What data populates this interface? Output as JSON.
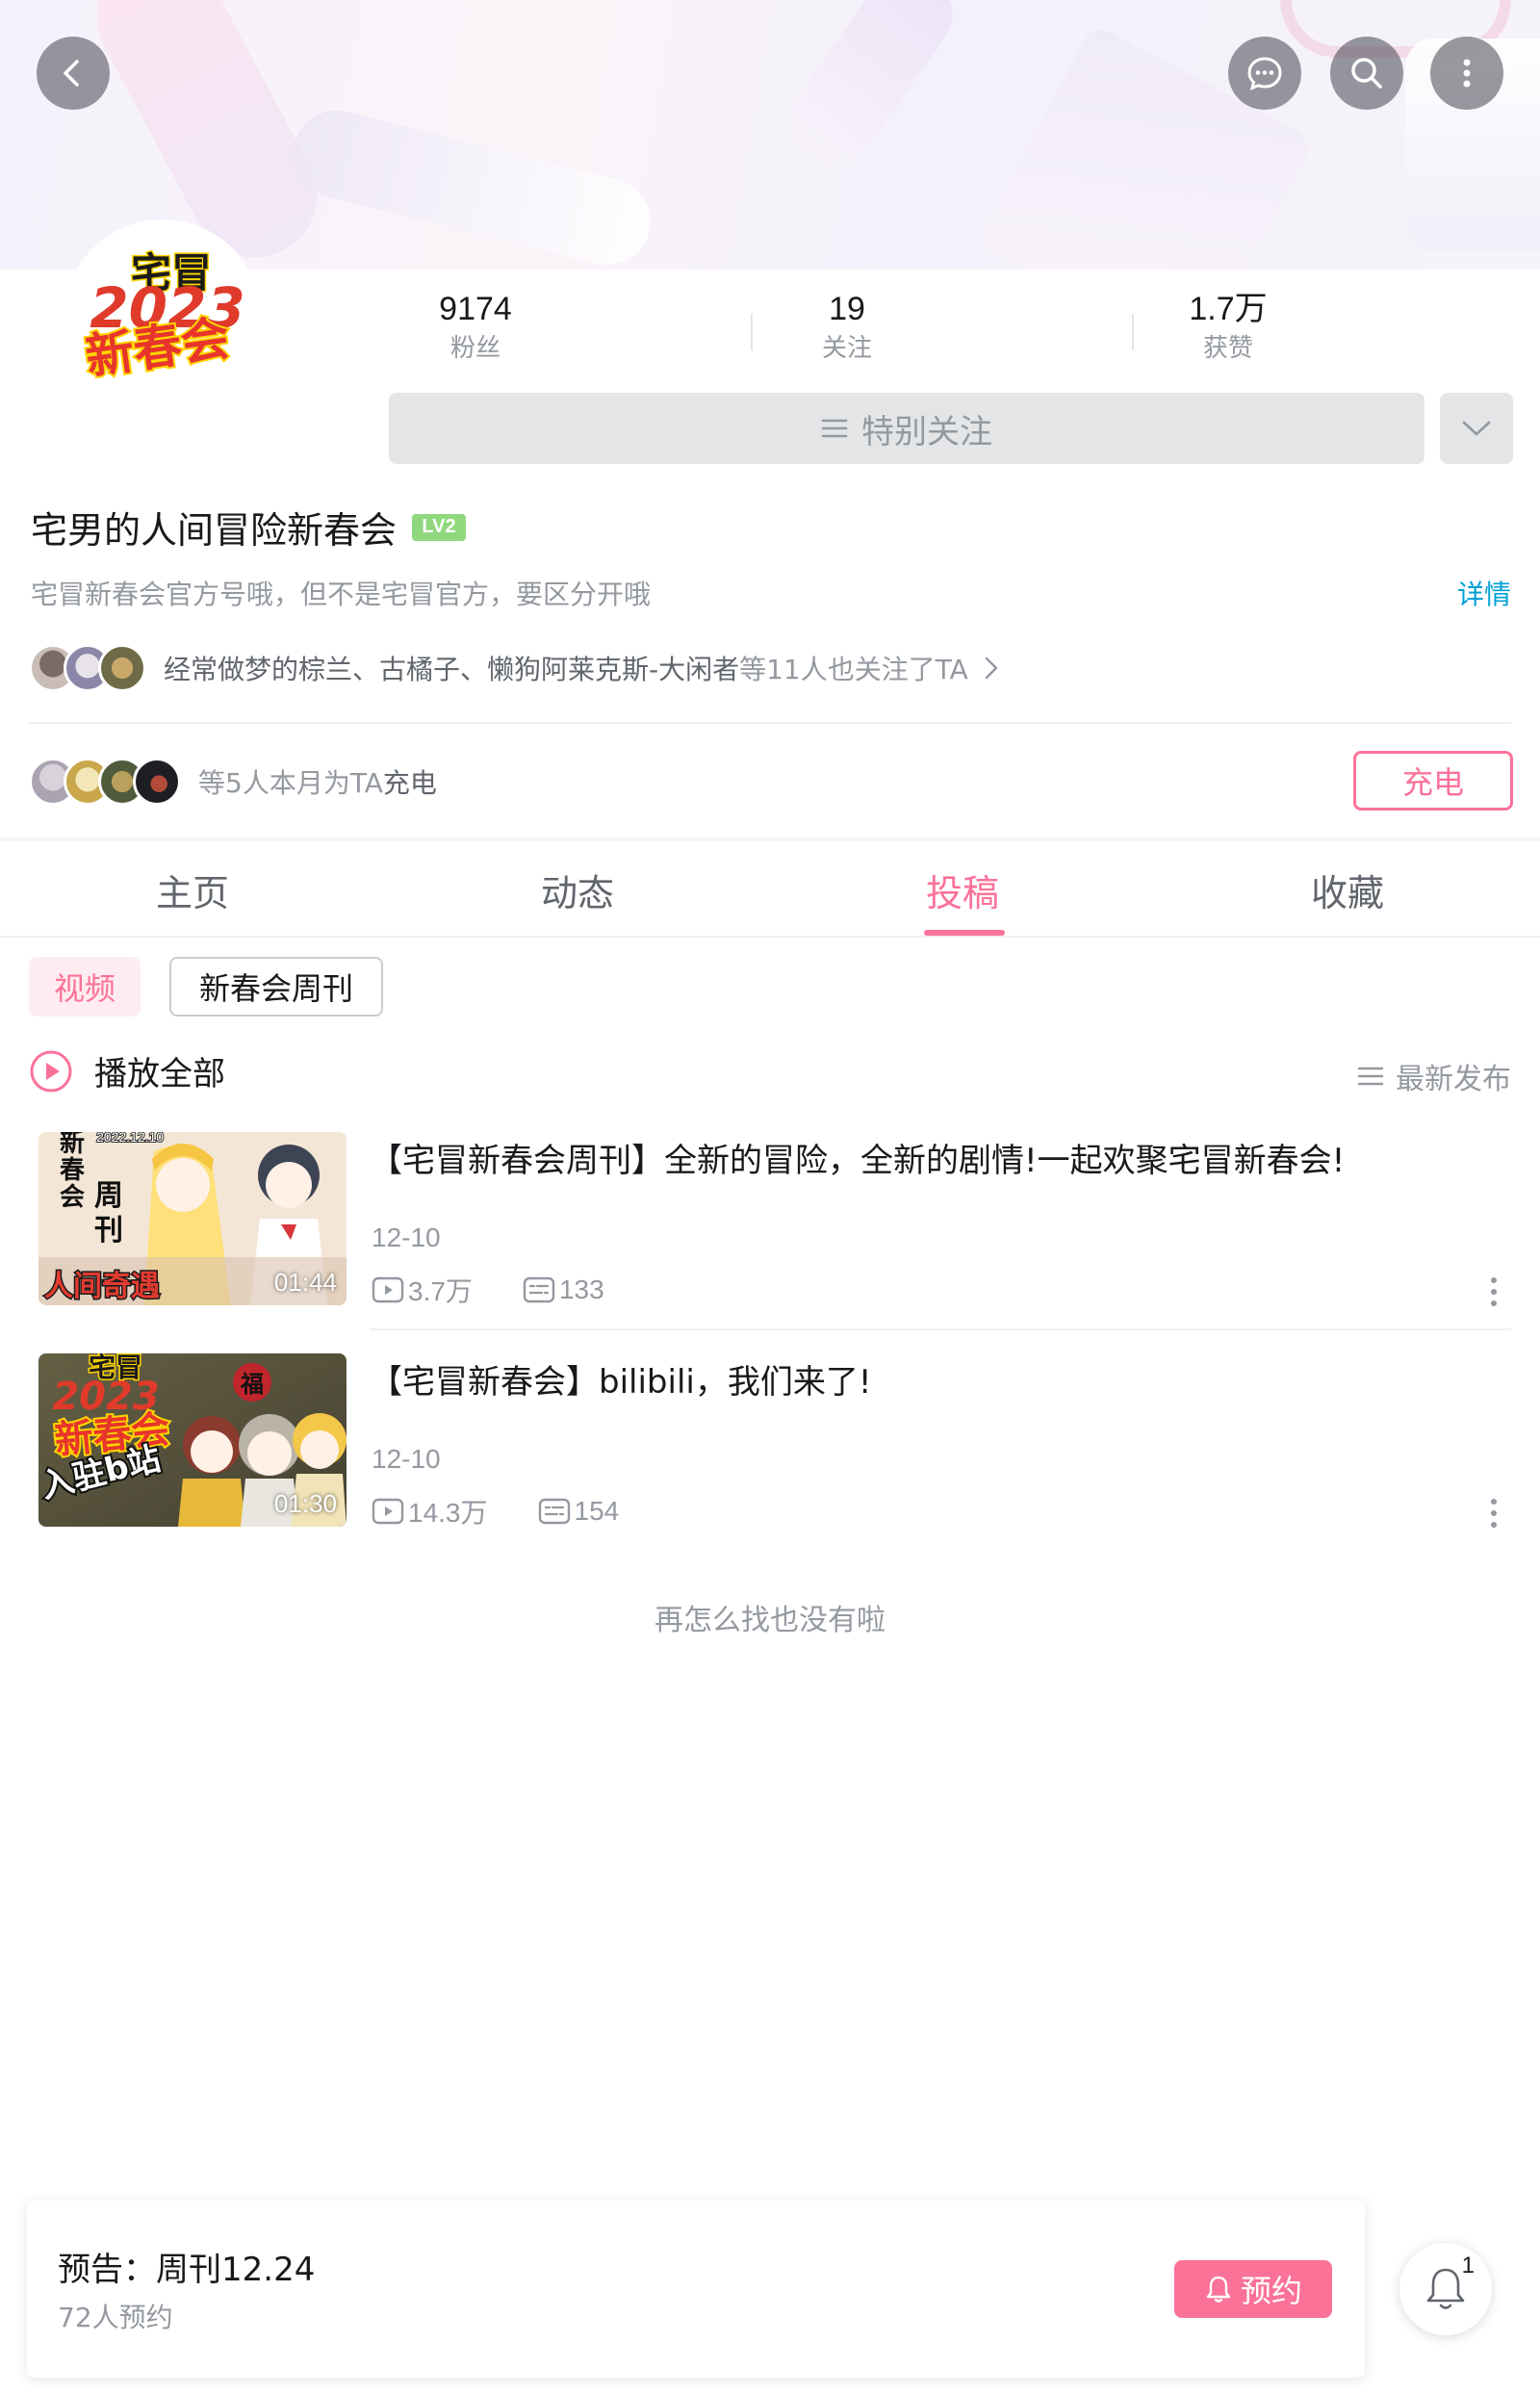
{
  "profile": {
    "avatar_text_top": "宅冒",
    "avatar_text_year": "2023",
    "avatar_text_main": "新春会",
    "stats": [
      {
        "value": "9174",
        "label": "粉丝"
      },
      {
        "value": "19",
        "label": "关注"
      },
      {
        "value": "1.7万",
        "label": "获赞"
      }
    ],
    "follow_label": "特别关注",
    "name": "宅男的人间冒险新春会",
    "level": "LV2",
    "sign": "宅冒新春会官方号哦，但不是宅冒官方，要区分开哦",
    "detail_label": "详情",
    "mutual_names": "经常做梦的棕兰、古橘子、懒狗阿莱克斯-大闲者",
    "mutual_suffix": "等11人也关注了TA",
    "charge_text": "等5人本月为TA",
    "charge_text_bold": "充电",
    "charge_button": "充电"
  },
  "tabs": [
    {
      "label": "主页"
    },
    {
      "label": "动态"
    },
    {
      "label": "投稿"
    },
    {
      "label": "收藏"
    }
  ],
  "active_tab": "投稿",
  "chips": [
    "视频",
    "新春会周刊"
  ],
  "play_all_label": "播放全部",
  "sort_label": "最新发布",
  "videos": [
    {
      "title": "【宅冒新春会周刊】全新的冒险，全新的剧情!一起欢聚宅冒新春会!",
      "date": "12-10",
      "views": "3.7万",
      "comments": "133",
      "duration": "01:44",
      "thumb_text": [
        "新",
        "春",
        "会",
        "周",
        "刊"
      ],
      "thumb_tag": "2022.12.10",
      "thumb_logo": "人间奇遇"
    },
    {
      "title": "【宅冒新春会】bilibili，我们来了!",
      "date": "12-10",
      "views": "14.3万",
      "comments": "154",
      "duration": "01:30",
      "thumb_logo": "新春会",
      "thumb_year": "2023",
      "thumb_caption": "入驻b站",
      "thumb_top": "宅冒",
      "thumb_fu": "福"
    }
  ],
  "end_text": "再怎么找也没有啦",
  "preview": {
    "title": "预告：周刊12.24",
    "subtitle": "72人预约",
    "button": "预约"
  },
  "notification_count": "1",
  "colors": {
    "accent": "#fb7299",
    "link": "#00a1d6",
    "level": "#8fd87e"
  }
}
